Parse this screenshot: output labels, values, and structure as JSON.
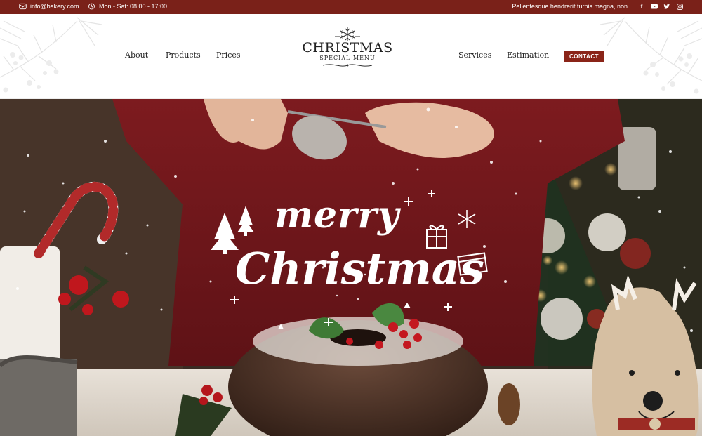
{
  "topbar": {
    "email": "info@bakery.com",
    "hours": "Mon - Sat: 08.00 - 17:00",
    "tagline": "Pellentesque hendrerit turpis magna, non",
    "social_icons": [
      "facebook-icon",
      "youtube-icon",
      "twitter-icon",
      "instagram-icon"
    ]
  },
  "nav": {
    "left": [
      "About",
      "Products",
      "Prices"
    ],
    "right": [
      "Services",
      "Estimation"
    ],
    "contact_label": "CONTACT"
  },
  "logo": {
    "title": "CHRISTMAS",
    "subtitle": "SPECIAL MENU"
  },
  "hero": {
    "line1": "merry",
    "line2": "Christmas"
  },
  "colors": {
    "brand": "#7a2119",
    "button": "#8a2418"
  }
}
